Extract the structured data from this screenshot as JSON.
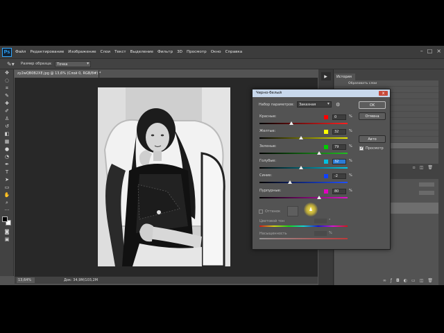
{
  "menubar": {
    "logo": "Ps",
    "items": [
      "Файл",
      "Редактирование",
      "Изображение",
      "Слои",
      "Текст",
      "Выделение",
      "Фильтр",
      "3D",
      "Просмотр",
      "Окно",
      "Справка"
    ]
  },
  "options": {
    "tool_icon": "eyedropper-icon",
    "sample_size_label": "Размер образца:",
    "sample_size_value": "Точка"
  },
  "document": {
    "tab_title": "zy2wQB0B2XE.jpg @ 13,6% (Слой 0, RGB/8#) *",
    "zoom": "13,64%",
    "doc_info": "Док: 34,9M/103,2M"
  },
  "panels": {
    "history_tab": "История",
    "history_items": [
      "Образовать слои",
      "",
      "анание",
      "",
      "",
      "",
      "",
      "",
      "слой",
      "слой",
      "слой"
    ]
  },
  "dialog": {
    "title": "Черно-белый",
    "close": "x",
    "preset_label": "Набор параметров:",
    "preset_value": "Заказная",
    "ok": "OK",
    "cancel": "Отмена",
    "auto": "Авто",
    "preview_label": "Просмотр",
    "preview_checked": true,
    "sliders": [
      {
        "label": "Красные:",
        "value": "0",
        "unit": "%",
        "color": "#ff0000",
        "thumb": 0.36,
        "track": "linear-gradient(90deg,#000,#ff2020)"
      },
      {
        "label": "Желтые:",
        "value": "32",
        "unit": "%",
        "color": "#ffff00",
        "thumb": 0.47,
        "track": "linear-gradient(90deg,#000,#e8e800)"
      },
      {
        "label": "Зеленые:",
        "value": "79",
        "unit": "%",
        "color": "#00cc00",
        "thumb": 0.68,
        "track": "linear-gradient(90deg,#000,#20c020)"
      },
      {
        "label": "Голубые:",
        "value": "32",
        "unit": "%",
        "color": "#00c0e0",
        "thumb": 0.47,
        "track": "linear-gradient(90deg,#000,#00c8e8)",
        "highlight": true
      },
      {
        "label": "Синие:",
        "value": "-2",
        "unit": "%",
        "color": "#1040ff",
        "thumb": 0.35,
        "track": "linear-gradient(90deg,#000,#2050ff)"
      },
      {
        "label": "Пурпурные:",
        "value": "80",
        "unit": "%",
        "color": "#e000c0",
        "thumb": 0.68,
        "track": "linear-gradient(90deg,#000,#e010c8)"
      }
    ],
    "tint_label": "Оттенок",
    "hue_label": "Цветовой тон",
    "hue_unit": "°",
    "saturation_label": "Насыщенность",
    "saturation_unit": "%"
  },
  "colors": {
    "app_bg": "#535353",
    "panel_bg": "#424242",
    "canvas_bg": "#282828",
    "dialog_title_bg": "#c8d8ec",
    "close_btn": "#c84a3a",
    "highlight_field": "#2b7bd6"
  }
}
